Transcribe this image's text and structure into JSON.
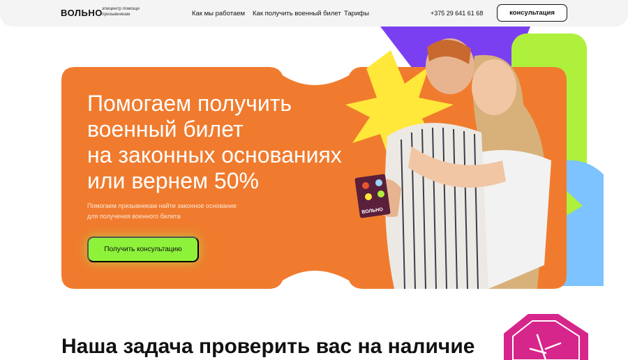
{
  "header": {
    "logo": "ВОЛЬНО",
    "tagline_line1": "эпицентр помощи",
    "tagline_line2": "призывникам",
    "nav": [
      "Как мы работаем",
      "Как получить военный билет",
      "Тарифы"
    ],
    "phone": "+375 29 641 61 68",
    "consult_button": "консультация"
  },
  "hero": {
    "title_lines": [
      "Помогаем получить",
      "военный билет",
      "на законных основаниях",
      "или вернем 50%"
    ],
    "subtitle_line1": "Помогаем призывникам найти законное основание",
    "subtitle_line2": "для получения военного билета",
    "button": "Получить консультацию",
    "card_text": "ВОЛЬНО"
  },
  "section": {
    "title": "Наша задача проверить вас на наличие"
  },
  "colors": {
    "orange": "#f07b2e",
    "lime": "#aef03c",
    "purple": "#7b3ff2",
    "yellow": "#ffe83a",
    "blue": "#7cc3ff",
    "magenta": "#d6268b"
  }
}
